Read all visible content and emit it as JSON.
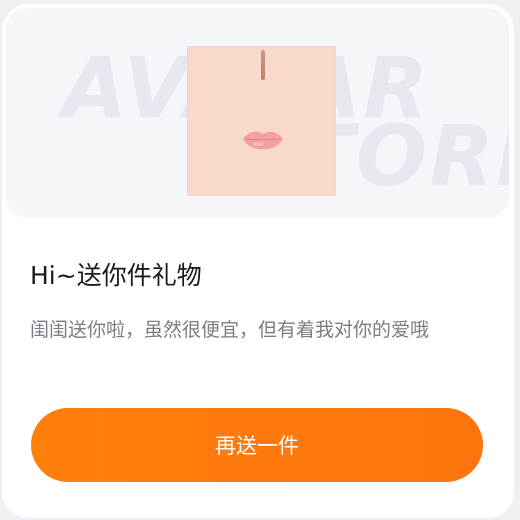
{
  "banner": {
    "watermark_line1": "AVATAR",
    "watermark_line2": "STORE"
  },
  "gift": {
    "title": "Hi~送你件礼物",
    "description": "闺闺送你啦，虽然很便宜，但有着我对你的爱哦"
  },
  "actions": {
    "send_again_label": "再送一件"
  },
  "colors": {
    "accent": "#fd7a0b",
    "title_text": "#1b1b1f",
    "description_text": "#7b7d85",
    "avatar_skin": "#f8d9cb"
  }
}
